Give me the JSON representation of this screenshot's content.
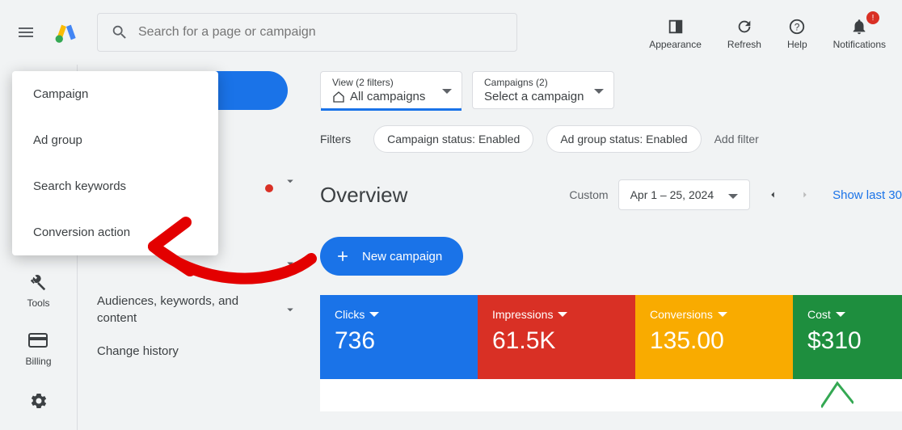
{
  "header": {
    "search_placeholder": "Search for a page or campaign",
    "actions": {
      "appearance": "Appearance",
      "refresh": "Refresh",
      "help": "Help",
      "notifications": "Notifications",
      "notif_badge": "!"
    }
  },
  "popup": {
    "items": [
      "Campaign",
      "Ad group",
      "Search keywords",
      "Conversion action"
    ]
  },
  "sidebar": {
    "rows_with_chevron_count": 3,
    "audiences": "Audiences, keywords, and content",
    "change_history": "Change history"
  },
  "leftrail": {
    "tools": "Tools",
    "billing": "Billing"
  },
  "selectors": {
    "view_small": "View (2 filters)",
    "view_big": "All campaigns",
    "camp_small": "Campaigns (2)",
    "camp_big": "Select a campaign"
  },
  "filters": {
    "label": "Filters",
    "chip1": "Campaign status: Enabled",
    "chip2": "Ad group status: Enabled",
    "add": "Add filter"
  },
  "overview": {
    "title": "Overview",
    "custom": "Custom",
    "date": "Apr 1 – 25, 2024",
    "show_last": "Show last 30"
  },
  "button": {
    "new_campaign": "New campaign"
  },
  "cards": {
    "clicks_label": "Clicks",
    "clicks_value": "736",
    "impr_label": "Impressions",
    "impr_value": "61.5K",
    "conv_label": "Conversions",
    "conv_value": "135.00",
    "cost_label": "Cost",
    "cost_value": "$310"
  }
}
